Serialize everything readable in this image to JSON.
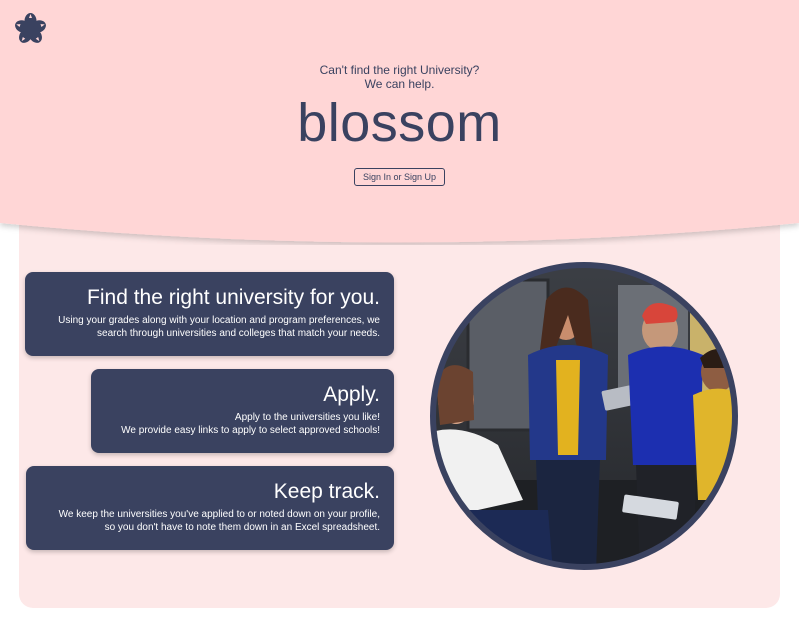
{
  "app": {
    "logo_icon": "flower-icon",
    "brand_color": "#3a4260",
    "hero_color": "#ffd6d6",
    "panel_color": "#fde8e8"
  },
  "hero": {
    "tagline_line1": "Can't find the right University?",
    "tagline_line2": "We can help.",
    "brand_name": "blossom",
    "signin_label": "Sign In or Sign Up"
  },
  "features": [
    {
      "title": "Find the right university for you.",
      "lines": [
        "Using your grades along with your location and program preferences, we",
        "search through universities and colleges that match your needs."
      ]
    },
    {
      "title": "Apply.",
      "lines": [
        "Apply to the universities you like!",
        "We provide easy links to apply to select approved schools!"
      ]
    },
    {
      "title": "Keep track.",
      "lines": [
        "We keep the universities you've applied to or noted down on your profile,",
        "so you don't have to note them down in an Excel spreadsheet."
      ]
    }
  ],
  "photo": {
    "subject": "group-of-students-photo"
  }
}
